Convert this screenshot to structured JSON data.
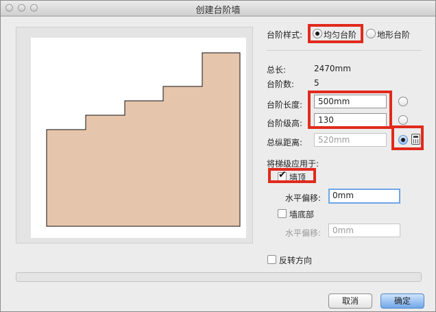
{
  "window": {
    "title": "创建台阶墙"
  },
  "style": {
    "label": "台阶样式:",
    "options": [
      {
        "label": "均匀台阶",
        "selected": true
      },
      {
        "label": "地形台阶",
        "selected": false
      }
    ]
  },
  "info": {
    "total_length_label": "总长:",
    "total_length_value": "2470mm",
    "step_count_label": "台阶数:",
    "step_count_value": "5"
  },
  "fields": {
    "step_length": {
      "label": "台阶长度:",
      "value": "500mm"
    },
    "step_height": {
      "label": "台阶级高:",
      "value": "130"
    },
    "total_vertical": {
      "label": "总纵距离:",
      "value": "520mm"
    }
  },
  "apply": {
    "label": "将梯级应用于:",
    "wall_top": {
      "label": "墙顶",
      "checked": true,
      "offset_label": "水平偏移:",
      "offset_value": "0mm"
    },
    "wall_bottom": {
      "label": "墙底部",
      "checked": false,
      "offset_label": "水平偏移:",
      "offset_value": "0mm"
    }
  },
  "reverse": {
    "label": "反转方向",
    "checked": false
  },
  "buttons": {
    "cancel": "取消",
    "ok": "确定"
  },
  "icons": {
    "calculator": "calculator-icon",
    "check": "checkmark-icon"
  },
  "colors": {
    "wall_fill": "#e5c5ab",
    "highlight": "#e02a1c",
    "accent": "#71a7ea"
  }
}
